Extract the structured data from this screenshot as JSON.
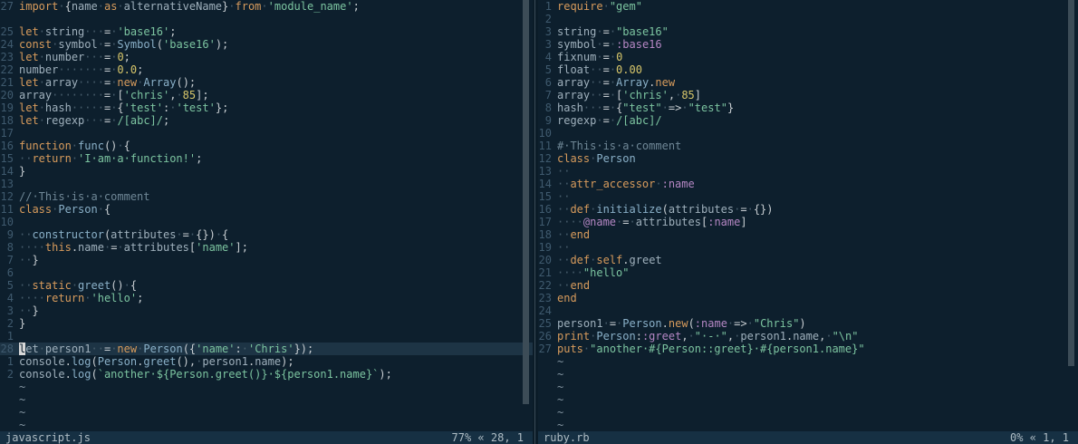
{
  "left_pane": {
    "status": {
      "filename": "javascript.js",
      "position": "77% « 28, 1"
    },
    "lines": [
      {
        "n": "27",
        "t": "import·{name·as·alternativeName}·from·'module_name';"
      },
      {
        "n": "",
        "t": ""
      },
      {
        "n": "25",
        "t": "let·string···=·'base16';"
      },
      {
        "n": "24",
        "t": "const·symbol·=·Symbol('base16');"
      },
      {
        "n": "23",
        "t": "let·number···=·0;"
      },
      {
        "n": "22",
        "t": "number·······=·0.0;"
      },
      {
        "n": "21",
        "t": "let·array····=·new·Array();"
      },
      {
        "n": "20",
        "t": "array········=·['chris',·85];"
      },
      {
        "n": "19",
        "t": "let·hash·····=·{'test':·'test'};"
      },
      {
        "n": "18",
        "t": "let·regexp···=·/[abc]/;"
      },
      {
        "n": "17",
        "t": ""
      },
      {
        "n": "16",
        "t": "function·func()·{"
      },
      {
        "n": "15",
        "t": "··return·'I·am·a·function!';"
      },
      {
        "n": "14",
        "t": "}"
      },
      {
        "n": "13",
        "t": ""
      },
      {
        "n": "12",
        "t": "//·This·is·a·comment"
      },
      {
        "n": "11",
        "t": "class·Person·{"
      },
      {
        "n": "10",
        "t": ""
      },
      {
        "n": "9",
        "t": "··constructor(attributes·=·{})·{"
      },
      {
        "n": "8",
        "t": "····this.name·=·attributes['name'];"
      },
      {
        "n": "7",
        "t": "··}"
      },
      {
        "n": "6",
        "t": ""
      },
      {
        "n": "5",
        "t": "··static·greet()·{"
      },
      {
        "n": "4",
        "t": "····return·'hello';"
      },
      {
        "n": "3",
        "t": "··}"
      },
      {
        "n": "2",
        "t": "}"
      },
      {
        "n": "1",
        "t": ""
      },
      {
        "n": "28",
        "t": "let·person1··=·new·Person({'name':·'Chris'});",
        "current": true
      },
      {
        "n": "1",
        "t": "console.log(Person.greet(),·person1.name);"
      },
      {
        "n": "2",
        "t": "console.log(`another·${Person.greet()}·${person1.name}`);"
      },
      {
        "n": "",
        "t": "~",
        "tilde": true
      },
      {
        "n": "",
        "t": "~",
        "tilde": true
      },
      {
        "n": "",
        "t": "~",
        "tilde": true
      },
      {
        "n": "",
        "t": "~",
        "tilde": true
      }
    ]
  },
  "right_pane": {
    "status": {
      "filename": "ruby.rb",
      "position": "0% « 1, 1"
    },
    "lines": [
      {
        "n": "1",
        "t": "require·\"gem\""
      },
      {
        "n": "2",
        "t": ""
      },
      {
        "n": "3",
        "t": "string·=·\"base16\""
      },
      {
        "n": "3",
        "t": "symbol·=·:base16"
      },
      {
        "n": "4",
        "t": "fixnum·=·0"
      },
      {
        "n": "5",
        "t": "float··=·0.00"
      },
      {
        "n": "6",
        "t": "array··=·Array.new"
      },
      {
        "n": "7",
        "t": "array··=·['chris',·85]"
      },
      {
        "n": "8",
        "t": "hash···=·{\"test\"·=>·\"test\"}"
      },
      {
        "n": "9",
        "t": "regexp·=·/[abc]/"
      },
      {
        "n": "10",
        "t": ""
      },
      {
        "n": "11",
        "t": "#·This·is·a·comment"
      },
      {
        "n": "12",
        "t": "class·Person"
      },
      {
        "n": "13",
        "t": "··"
      },
      {
        "n": "14",
        "t": "··attr_accessor·:name"
      },
      {
        "n": "15",
        "t": "··"
      },
      {
        "n": "16",
        "t": "··def·initialize(attributes·=·{})"
      },
      {
        "n": "17",
        "t": "····@name·=·attributes[:name]"
      },
      {
        "n": "18",
        "t": "··end"
      },
      {
        "n": "19",
        "t": "··"
      },
      {
        "n": "20",
        "t": "··def·self.greet"
      },
      {
        "n": "21",
        "t": "····\"hello\""
      },
      {
        "n": "22",
        "t": "··end"
      },
      {
        "n": "23",
        "t": "end"
      },
      {
        "n": "24",
        "t": ""
      },
      {
        "n": "25",
        "t": "person1·=·Person.new(:name·=>·\"Chris\")"
      },
      {
        "n": "26",
        "t": "print·Person::greet,·\"·-·\",·person1.name,·\"\\n\""
      },
      {
        "n": "27",
        "t": "puts·\"another·#{Person::greet}·#{person1.name}\""
      },
      {
        "n": "",
        "t": "~",
        "tilde": true
      },
      {
        "n": "",
        "t": "~",
        "tilde": true
      },
      {
        "n": "",
        "t": "~",
        "tilde": true
      },
      {
        "n": "",
        "t": "~",
        "tilde": true
      },
      {
        "n": "",
        "t": "~",
        "tilde": true
      },
      {
        "n": "",
        "t": "~",
        "tilde": true
      }
    ]
  }
}
